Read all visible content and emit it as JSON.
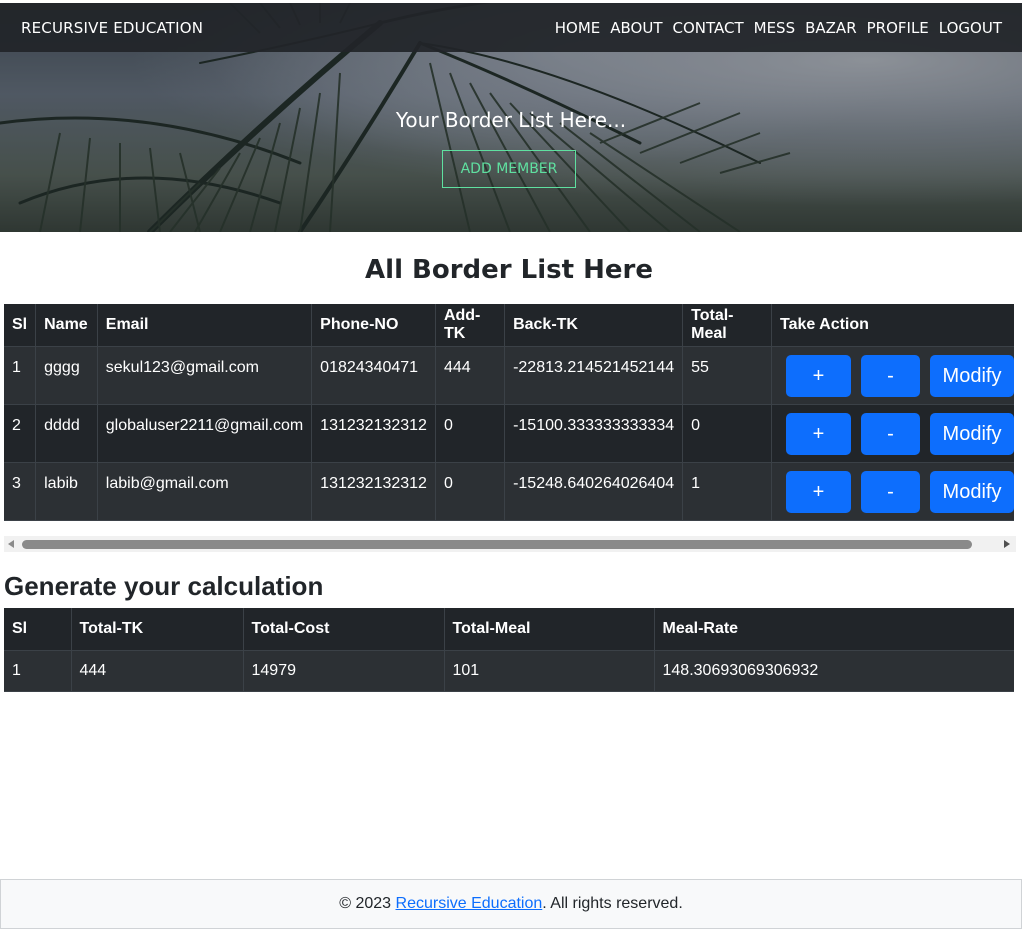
{
  "navbar": {
    "brand": "RECURSIVE EDUCATION",
    "links": [
      "HOME",
      "ABOUT",
      "CONTACT",
      "MESS",
      "BAZAR",
      "PROFILE",
      "LOGOUT"
    ]
  },
  "hero": {
    "title": "Your Border List Here...",
    "add_button": "ADD MEMBER"
  },
  "border_list": {
    "title": "All Border List Here",
    "columns": [
      "Sl",
      "Name",
      "Email",
      "Phone-NO",
      "Add-TK",
      "Back-TK",
      "Total-Meal",
      "Take Action"
    ],
    "rows": [
      {
        "sl": "1",
        "name": "gggg",
        "email": "sekul123@gmail.com",
        "phone": "01824340471",
        "add_tk": "444",
        "back_tk": "-22813.214521452144",
        "total_meal": "55"
      },
      {
        "sl": "2",
        "name": "dddd",
        "email": "globaluser2211@gmail.com",
        "phone": "131232132312",
        "add_tk": "0",
        "back_tk": "-15100.333333333334",
        "total_meal": "0"
      },
      {
        "sl": "3",
        "name": "labib",
        "email": "labib@gmail.com",
        "phone": "131232132312",
        "add_tk": "0",
        "back_tk": "-15248.640264026404",
        "total_meal": "1"
      }
    ],
    "actions": {
      "plus": "+",
      "minus": "-",
      "modify": "Modify"
    }
  },
  "calculation": {
    "title": "Generate your calculation",
    "columns": [
      "Sl",
      "Total-TK",
      "Total-Cost",
      "Total-Meal",
      "Meal-Rate"
    ],
    "rows": [
      {
        "sl": "1",
        "total_tk": "444",
        "total_cost": "14979",
        "total_meal": "101",
        "meal_rate": "148.30693069306932"
      }
    ]
  },
  "footer": {
    "prefix": "© 2023 ",
    "link": "Recursive Education",
    "suffix": ". All rights reserved."
  },
  "colors": {
    "navbar_bg": "#212529",
    "table_dark": "#212529",
    "button_primary": "#0d6efd",
    "add_member_accent": "#5fe0a0",
    "link": "#0d6efd"
  }
}
